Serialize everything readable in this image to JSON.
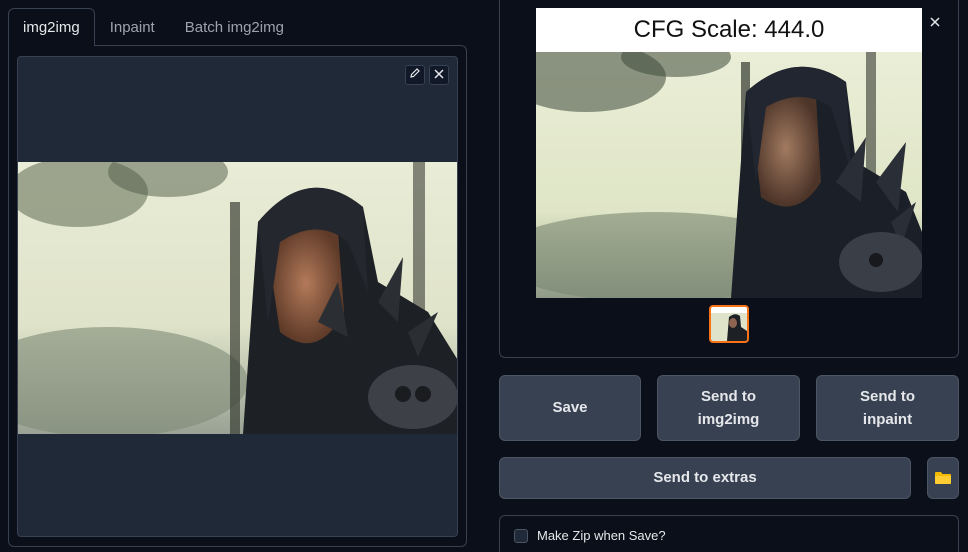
{
  "tabs": [
    {
      "label": "img2img",
      "active": true
    },
    {
      "label": "Inpaint",
      "active": false
    },
    {
      "label": "Batch img2img",
      "active": false
    }
  ],
  "input_image": {
    "edit_icon": "pencil-icon",
    "clear_icon": "close-icon"
  },
  "result": {
    "caption": "CFG Scale: 444.0",
    "close_icon": "close-icon"
  },
  "buttons": {
    "save": "Save",
    "send_img2img": "Send to img2img",
    "send_inpaint": "Send to inpaint",
    "send_extras": "Send to extras",
    "folder_icon": "folder-icon"
  },
  "zip": {
    "label": "Make Zip when Save?",
    "checked": false
  },
  "colors": {
    "background": "#0b0f19",
    "panel": "#1f2937",
    "button": "#374151",
    "accent": "#f97316",
    "folder": "#f5b800"
  }
}
